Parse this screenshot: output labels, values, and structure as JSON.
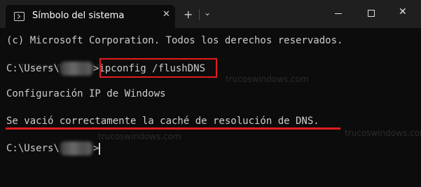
{
  "window": {
    "tab_title": "Símbolo del sistema",
    "tab_close": "✕",
    "new_tab": "+",
    "dropdown": "⌄",
    "close_glyph": "✕"
  },
  "terminal": {
    "copyright": "(c) Microsoft Corporation. Todos los derechos reservados.",
    "prompt_prefix": "C:\\Users\\",
    "prompt_suffix": ">",
    "command": "ipconfig /flushDNS",
    "header": "Configuración IP de Windows",
    "result": "Se vació correctamente la caché de resolución de DNS."
  },
  "watermarks": [
    "trucoswindows.com",
    "trucoswindows.com",
    "trucoswindows.com",
    "trucoswindows.com"
  ],
  "colors": {
    "highlight": "#e01e1e",
    "text": "#cccccc",
    "background": "#0c0c0c"
  }
}
